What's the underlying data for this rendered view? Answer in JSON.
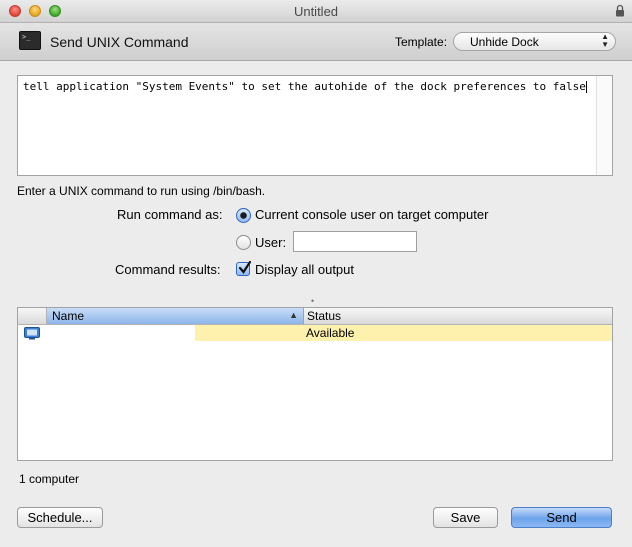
{
  "window": {
    "title": "Untitled"
  },
  "header": {
    "title": "Send UNIX Command",
    "template_label": "Template:",
    "template_value": "Unhide Dock"
  },
  "editor": {
    "command": "tell application \"System Events\" to set the autohide of the dock preferences to false"
  },
  "hint": "Enter a UNIX command to run using /bin/bash.",
  "run_as": {
    "label": "Run command as:",
    "option_console": "Current console user on target computer",
    "option_user": "User:",
    "user_value": "",
    "selected": "console"
  },
  "results": {
    "label": "Command results:",
    "checkbox_label": "Display all output",
    "checked": true
  },
  "list": {
    "columns": {
      "name": "Name",
      "status": "Status"
    },
    "rows": [
      {
        "name": "",
        "status": "Available"
      }
    ],
    "count_text": "1 computer"
  },
  "buttons": {
    "schedule": "Schedule...",
    "save": "Save",
    "send": "Send"
  },
  "colors": {
    "selection": "#8db5ea",
    "row_highlight": "#fdf1ad",
    "default_button": "#6ea3ec"
  }
}
